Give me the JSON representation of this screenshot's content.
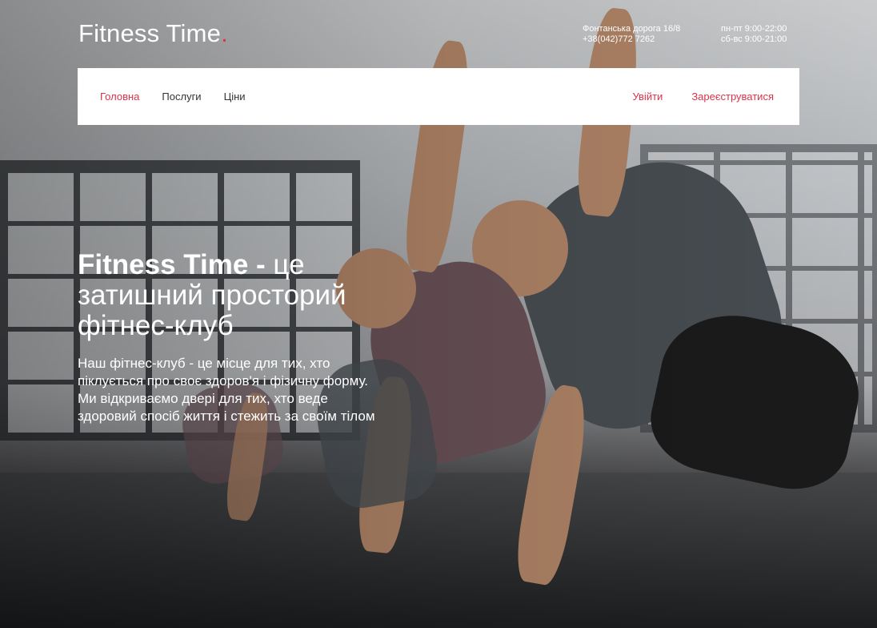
{
  "brand": {
    "name": "Fitness Time",
    "dot": ".",
    "accent_color": "#e0334d"
  },
  "contact": {
    "address": "Фонтанська дорога 16/8",
    "phone": "+38(042)772 7262"
  },
  "hours": {
    "weekdays_label": "пн-пт",
    "weekdays_time": "9:00-22:00",
    "weekend_label": "сб-вс",
    "weekend_time": "9:00-21:00"
  },
  "nav": {
    "items": [
      {
        "label": "Головна",
        "active": true
      },
      {
        "label": "Послуги",
        "active": false
      },
      {
        "label": "Ціни",
        "active": false
      }
    ],
    "login": "Увійти",
    "register": "Зареєструватися"
  },
  "hero": {
    "title_strong": "Fitness Time -",
    "title_rest": " це затишний просторий фітнес-клуб",
    "text": "Наш фітнес-клуб - це місце для тих, хто піклується про своє здоров'я і фізичну форму. Ми відкриваємо двері для тих, хто веде здоровий спосіб життя і стежить за своїм тілом"
  }
}
